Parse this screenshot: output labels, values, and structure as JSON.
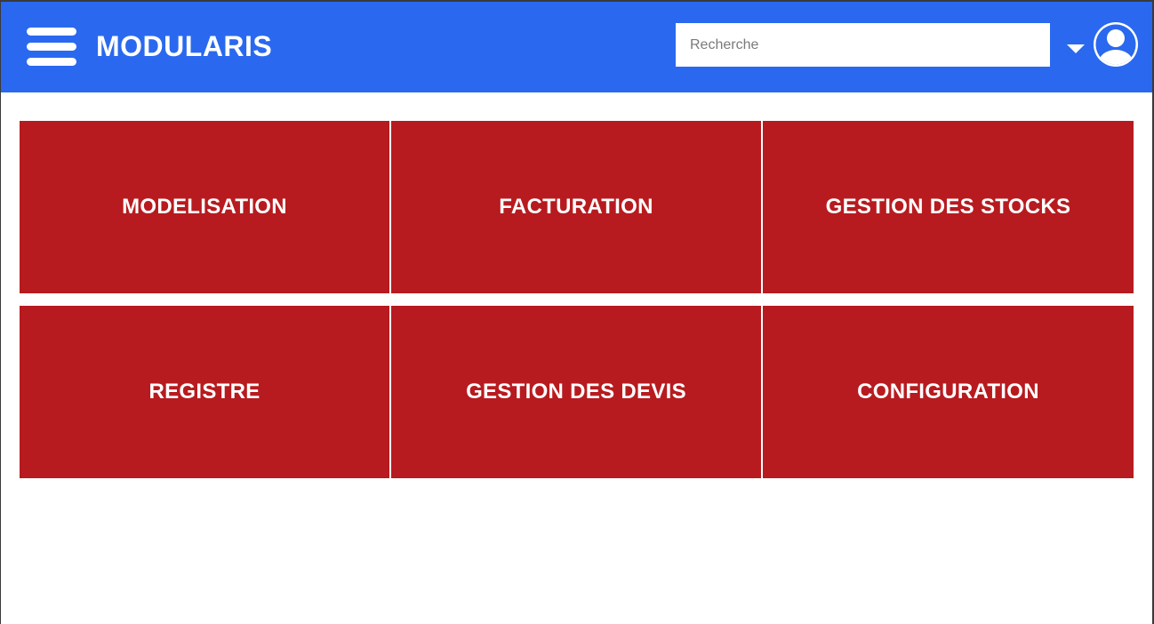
{
  "header": {
    "brand": "MODULARIS",
    "search_placeholder": "Recherche",
    "background_color": "#2a69ef"
  },
  "icons": {
    "menu": "hamburger-menu-icon",
    "caret": "caret-down-icon",
    "avatar": "user-avatar-icon"
  },
  "tiles": [
    {
      "label": "MODELISATION"
    },
    {
      "label": "FACTURATION"
    },
    {
      "label": "GESTION DES STOCKS"
    },
    {
      "label": "REGISTRE"
    },
    {
      "label": "GESTION DES DEVIS"
    },
    {
      "label": "CONFIGURATION"
    }
  ],
  "tile_color": "#b71b1f"
}
